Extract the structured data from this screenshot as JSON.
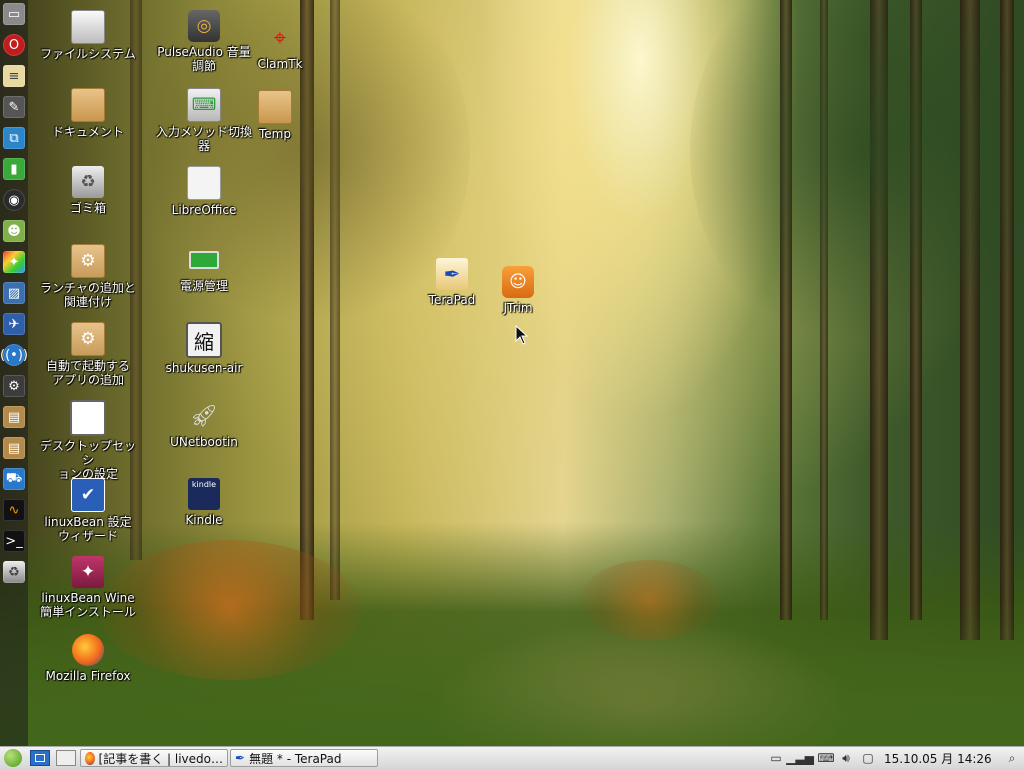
{
  "desktop_icons": [
    {
      "label": "ファイルシステム",
      "icon": "drive-icon"
    },
    {
      "label": "PulseAudio 音量\n調節",
      "icon": "speaker-icon"
    },
    {
      "label": "ClamTk",
      "icon": "target-icon"
    },
    {
      "label": "ドキュメント",
      "icon": "folder-icon"
    },
    {
      "label": "入力メソッド切換\n器",
      "icon": "keyboard-icon"
    },
    {
      "label": "Temp",
      "icon": "folder-icon"
    },
    {
      "label": "ゴミ箱",
      "icon": "trash-icon"
    },
    {
      "label": "LibreOffice",
      "icon": "document-icon"
    },
    {
      "label": "ランチャの追加と\n関連付け",
      "icon": "gear-folder-icon"
    },
    {
      "label": "電源管理",
      "icon": "battery-icon"
    },
    {
      "label": "自動で起動する\nアプリの追加",
      "icon": "gear-folder-icon"
    },
    {
      "label": "shukusen-air",
      "icon": "kanji-icon"
    },
    {
      "label": "デスクトップセッシ\nョンの設定",
      "icon": "window-icon"
    },
    {
      "label": "UNetbootin",
      "icon": "rocket-icon"
    },
    {
      "label": "linuxBean 設定\nウィザード",
      "icon": "checkbox-icon"
    },
    {
      "label": "Kindle",
      "icon": "kindle-icon"
    },
    {
      "label": "linuxBean Wine\n簡単インストール",
      "icon": "wine-icon"
    },
    {
      "label": "Mozilla Firefox",
      "icon": "firefox-icon"
    },
    {
      "label": "TeraPad",
      "icon": "pen-icon"
    },
    {
      "label": "JTrim",
      "icon": "smile-icon"
    }
  ],
  "kindle_badge": "kindle",
  "shukusen_glyph": "縮",
  "taskbar": {
    "tasks": [
      {
        "label": "[記事を書く | livedo…",
        "icon": "firefox-icon"
      },
      {
        "label": "無題 * - TeraPad",
        "icon": "pen-icon"
      }
    ],
    "clock": "15.10.05 月 14:26"
  },
  "colors": {
    "taskbar_bg": "#e4e4e4",
    "dock_bg": "#303030",
    "label_text": "#ffffff"
  }
}
